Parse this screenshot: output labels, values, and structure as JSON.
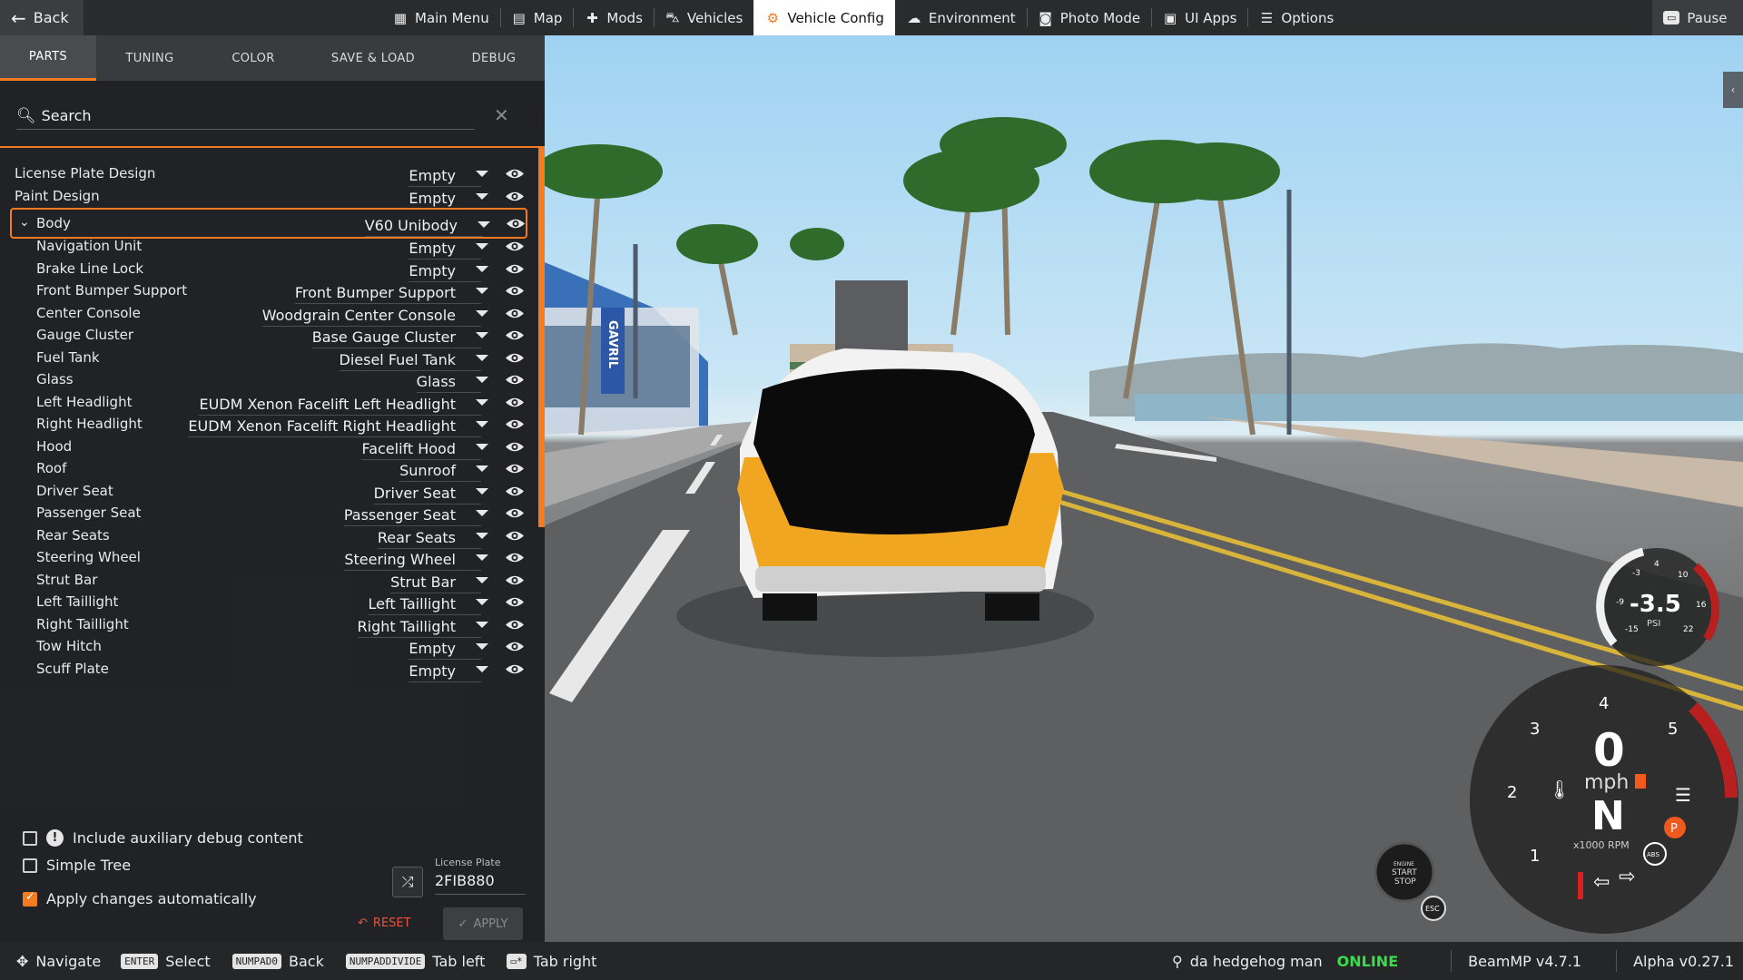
{
  "topbar": {
    "back_label": "Back",
    "menu": [
      {
        "label": "Main Menu",
        "icon": "grid-icon"
      },
      {
        "label": "Map",
        "icon": "map-icon"
      },
      {
        "label": "Mods",
        "icon": "puzzle-icon"
      },
      {
        "label": "Vehicles",
        "icon": "car-icon"
      },
      {
        "label": "Vehicle Config",
        "icon": "car-config-icon",
        "active": true
      },
      {
        "label": "Environment",
        "icon": "weather-icon"
      },
      {
        "label": "Photo Mode",
        "icon": "camera-icon"
      },
      {
        "label": "UI Apps",
        "icon": "apps-icon"
      },
      {
        "label": "Options",
        "icon": "sliders-icon"
      }
    ],
    "pause_label": "Pause"
  },
  "tabs": [
    "PARTS",
    "TUNING",
    "COLOR",
    "SAVE & LOAD",
    "DEBUG"
  ],
  "search": {
    "placeholder": "Search"
  },
  "parts": [
    {
      "label": "License Plate Design",
      "value": "Empty",
      "level": 0
    },
    {
      "label": "Paint Design",
      "value": "Empty",
      "level": 0
    },
    {
      "label": "Body",
      "value": "V60 Unibody",
      "level": 0,
      "expanded": true
    },
    {
      "label": "Navigation Unit",
      "value": "Empty",
      "level": 1
    },
    {
      "label": "Brake Line Lock",
      "value": "Empty",
      "level": 1
    },
    {
      "label": "Front Bumper Support",
      "value": "Front Bumper Support",
      "level": 1
    },
    {
      "label": "Center Console",
      "value": "Woodgrain Center Console",
      "level": 1
    },
    {
      "label": "Gauge Cluster",
      "value": "Base Gauge Cluster",
      "level": 1
    },
    {
      "label": "Fuel Tank",
      "value": "Diesel Fuel Tank",
      "level": 1
    },
    {
      "label": "Glass",
      "value": "Glass",
      "level": 1
    },
    {
      "label": "Left Headlight",
      "value": "EUDM Xenon Facelift Left Headlight",
      "level": 1
    },
    {
      "label": "Right Headlight",
      "value": "EUDM Xenon Facelift Right Headlight",
      "level": 1
    },
    {
      "label": "Hood",
      "value": "Facelift Hood",
      "level": 1
    },
    {
      "label": "Roof",
      "value": "Sunroof",
      "level": 1
    },
    {
      "label": "Driver Seat",
      "value": "Driver Seat",
      "level": 1
    },
    {
      "label": "Passenger Seat",
      "value": "Passenger Seat",
      "level": 1
    },
    {
      "label": "Rear Seats",
      "value": "Rear Seats",
      "level": 1
    },
    {
      "label": "Steering Wheel",
      "value": "Steering Wheel",
      "level": 1
    },
    {
      "label": "Strut Bar",
      "value": "Strut Bar",
      "level": 1
    },
    {
      "label": "Left Taillight",
      "value": "Left Taillight",
      "level": 1
    },
    {
      "label": "Right Taillight",
      "value": "Right Taillight",
      "level": 1
    },
    {
      "label": "Tow Hitch",
      "value": "Empty",
      "level": 1
    },
    {
      "label": "Scuff Plate",
      "value": "Empty",
      "level": 1
    }
  ],
  "options": {
    "aux_debug": {
      "label": "Include auxiliary debug content",
      "checked": false
    },
    "simple_tree": {
      "label": "Simple Tree",
      "checked": false
    },
    "apply_auto": {
      "label": "Apply changes automatically",
      "checked": true
    }
  },
  "license_plate": {
    "label": "License Plate",
    "value": "2FIB880"
  },
  "buttons": {
    "reset": "RESET",
    "apply": "APPLY"
  },
  "hud": {
    "boost_value": "-3.5",
    "boost_unit": "PSI",
    "boost_ticks": [
      "-3",
      "4",
      "10",
      "-9",
      "16",
      "-15",
      "22"
    ],
    "speed": "0",
    "speed_unit": "mph",
    "gear": "N",
    "rpm_unit": "x1000 RPM",
    "rpm_ticks": [
      "1",
      "2",
      "3",
      "4",
      "5"
    ],
    "engine_btn": [
      "ENGINE",
      "START",
      "STOP"
    ],
    "esc": "ESC",
    "abs": "ABS",
    "park": "P"
  },
  "scene_text": {
    "dealer_sign": "GAVRIL"
  },
  "bottombar": {
    "hints": [
      {
        "key": "",
        "label": "Navigate"
      },
      {
        "key": "ENTER",
        "label": "Select"
      },
      {
        "key": "NUMPAD0",
        "label": "Back"
      },
      {
        "key": "NUMPADDIVIDE",
        "label": "Tab left"
      },
      {
        "key": "",
        "label": "Tab right"
      }
    ],
    "username": "da hedgehog man",
    "online": "ONLINE",
    "beammp": "BeamMP v4.7.1",
    "version": "Alpha v0.27.1"
  },
  "colors": {
    "accent": "#f47b20",
    "online": "#3adc4b",
    "reset": "#e8533b"
  }
}
